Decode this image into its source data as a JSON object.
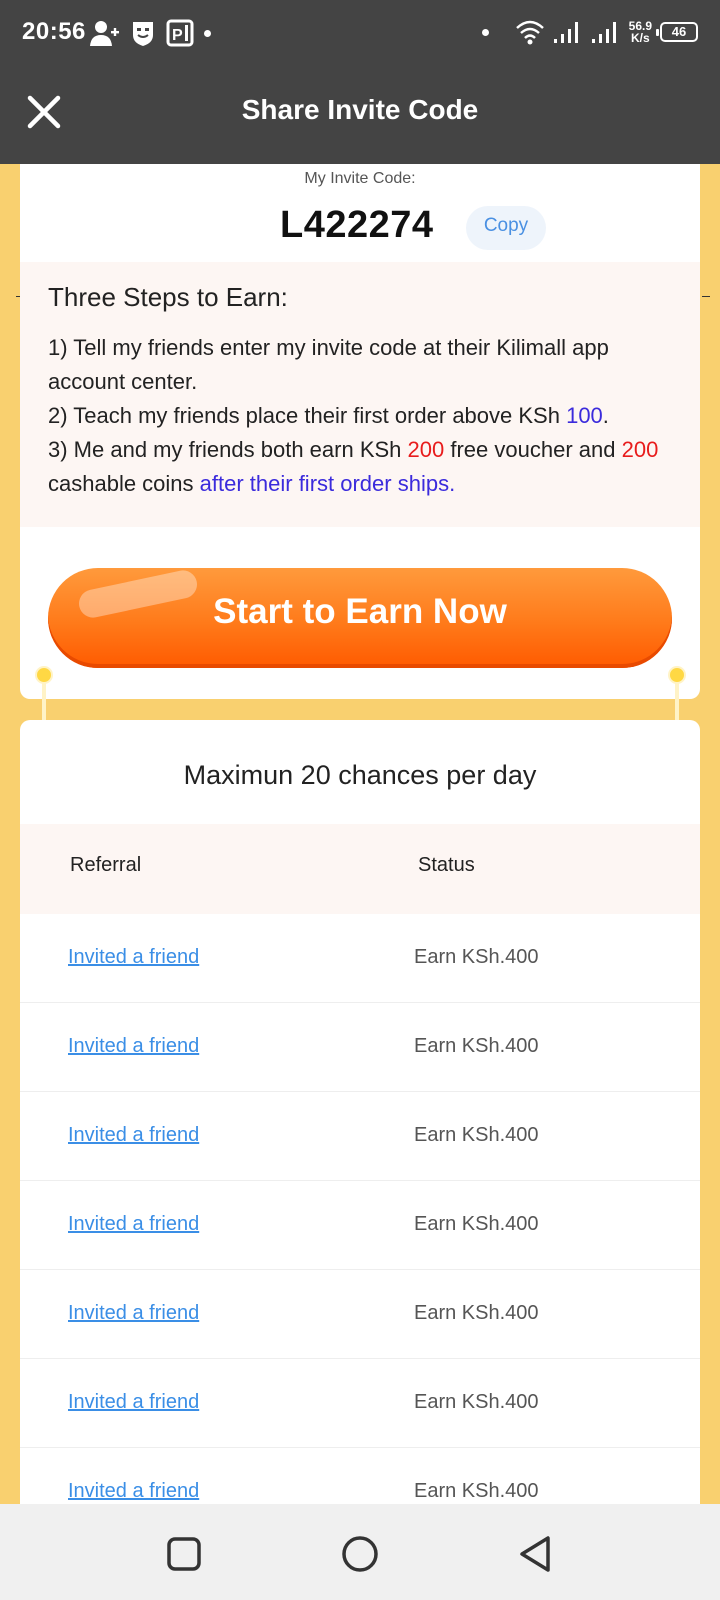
{
  "status_bar": {
    "time": "20:56",
    "net_speed_value": "56.9",
    "net_speed_unit": "K/s",
    "battery": "46",
    "icons_left": [
      "add-person-icon",
      "shield-face-icon",
      "parking-app-icon",
      "notification-dot-icon"
    ],
    "icons_right": [
      "dot-icon",
      "wifi-icon",
      "signal-icon",
      "signal-icon",
      "battery-icon"
    ]
  },
  "app_bar": {
    "title": "Share Invite Code",
    "close_icon": "close-icon"
  },
  "invite": {
    "label": "My Invite Code:",
    "code": "L422274",
    "copy_label": "Copy"
  },
  "steps": {
    "heading": "Three Steps to Earn:",
    "step1": "1) Tell my friends enter my invite code at their Kilimall app account center.",
    "step2_prefix": "2) Teach my friends place their first order above KSh ",
    "step2_amount": "100",
    "step2_suffix": ".",
    "step3_prefix": "3) Me and my friends both earn KSh ",
    "step3_voucher": "200",
    "step3_mid": " free voucher and ",
    "step3_coins": "200",
    "step3_coins_text": " cashable coins ",
    "step3_when": "after their first order ships."
  },
  "earn_button": "Start to Earn Now",
  "referrals": {
    "chances_text": "Maximun 20 chances per day",
    "col_referral": "Referral",
    "col_status": "Status",
    "rows": [
      {
        "referral": "Invited a friend",
        "status": "Earn KSh.400"
      },
      {
        "referral": "Invited a friend",
        "status": "Earn KSh.400"
      },
      {
        "referral": "Invited a friend",
        "status": "Earn KSh.400"
      },
      {
        "referral": "Invited a friend",
        "status": "Earn KSh.400"
      },
      {
        "referral": "Invited a friend",
        "status": "Earn KSh.400"
      },
      {
        "referral": "Invited a friend",
        "status": "Earn KSh.400"
      },
      {
        "referral": "Invited a friend",
        "status": "Earn KSh.400"
      }
    ]
  },
  "nav_bar": {
    "icons": [
      "recent-apps-icon",
      "home-icon",
      "back-icon"
    ]
  },
  "colors": {
    "header_bg": "#444444",
    "page_bg": "#f9d06f",
    "accent_orange": "#ff7a1a",
    "link_blue": "#3a8ee6",
    "highlight_blue": "#3b2bdc",
    "highlight_red": "#e81c1c"
  }
}
